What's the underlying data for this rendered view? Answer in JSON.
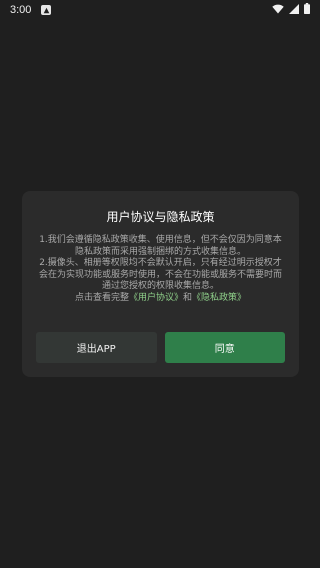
{
  "status_bar": {
    "time": "3:00",
    "icons": [
      "app-notification-icon",
      "wifi-icon",
      "cell-signal-icon",
      "battery-icon"
    ]
  },
  "dialog": {
    "title": "用户协议与隐私政策",
    "line1": "1.我们会遵循隐私政策收集、使用信息，但不会仅因为同意本隐私政策而采用强制捆绑的方式收集信息。",
    "line2": "2.摄像头、相册等权限均不会默认开启，只有经过明示授权才会在为实现功能或服务时使用，不会在功能或服务不需要时而通过您授权的权限收集信息。",
    "link_prefix": "点击查看完整",
    "link_user_agreement": "《用户协议》",
    "link_and": "和",
    "link_privacy_policy": "《隐私政策》",
    "exit_button": "退出APP",
    "agree_button": "同意"
  },
  "colors": {
    "background": "#1f1f1f",
    "dialog": "#2b2b2b",
    "exit_button": "#333735",
    "agree_button": "#2f7f4a",
    "link": "#8fd08a"
  }
}
